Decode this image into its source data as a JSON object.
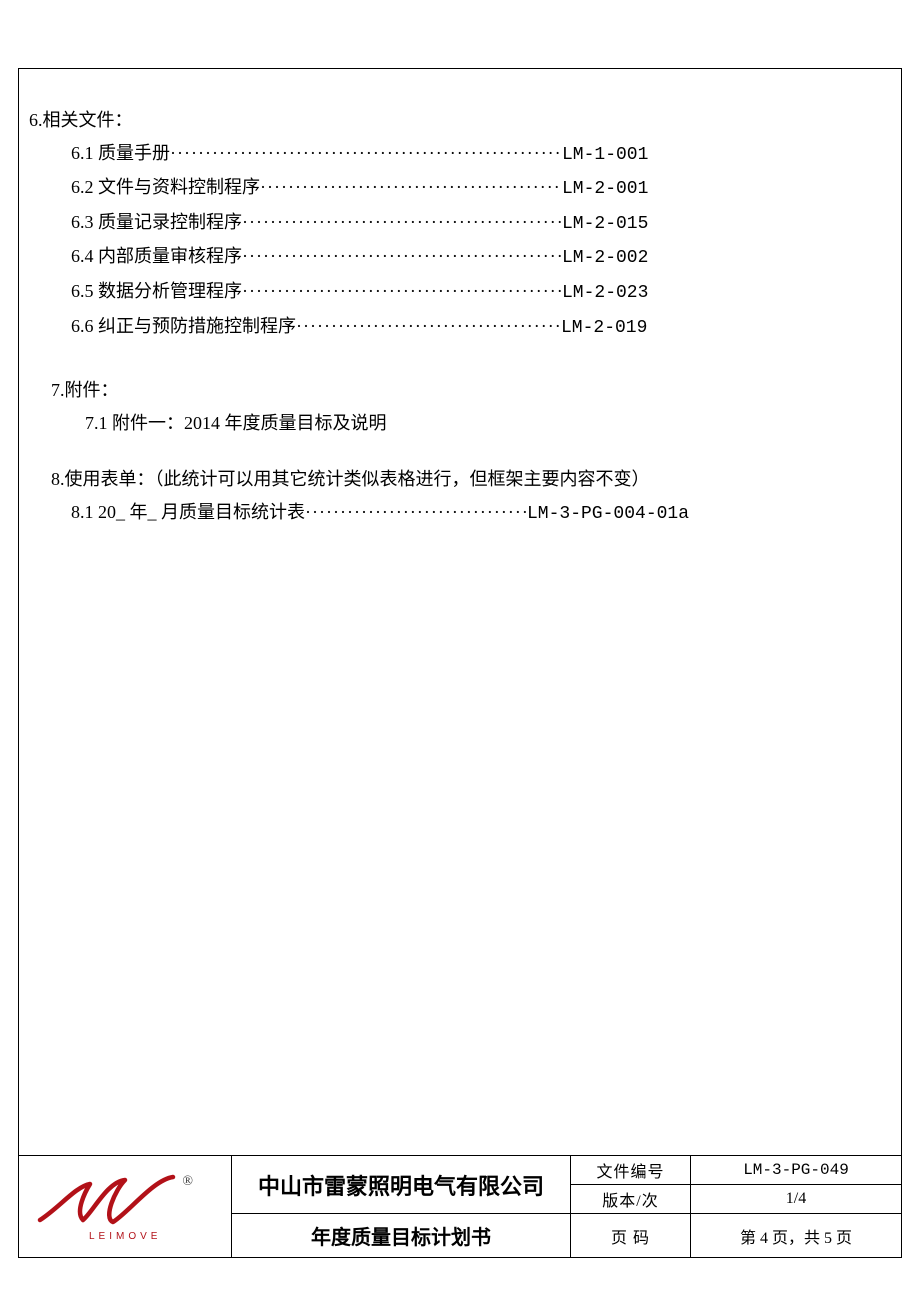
{
  "section6": {
    "title": "6.相关文件：",
    "items": [
      {
        "label": "6.1 质量手册",
        "code": "LM-1-001"
      },
      {
        "label": "6.2 文件与资料控制程序",
        "code": "LM-2-001"
      },
      {
        "label": "6.3 质量记录控制程序",
        "code": "LM-2-015"
      },
      {
        "label": "6.4 内部质量审核程序",
        "code": "LM-2-002"
      },
      {
        "label": "6.5 数据分析管理程序",
        "code": "LM-2-023"
      },
      {
        "label": "6.6 纠正与预防措施控制程序",
        "code": "LM-2-019"
      }
    ]
  },
  "section7": {
    "title": "7.附件：",
    "item": "7.1 附件一：2014 年度质量目标及说明"
  },
  "section8": {
    "title": "8.使用表单：（此统计可以用其它统计类似表格进行，但框架主要内容不变）",
    "item_label": "8.1 20_ 年_ 月质量目标统计表",
    "item_code": "LM-3-PG-004-01a"
  },
  "footer": {
    "logo_text": "LEIMOVE",
    "registered": "®",
    "company": "中山市雷蒙照明电气有限公司",
    "doc_title": "年度质量目标计划书",
    "labels": {
      "doc_no": "文件编号",
      "version": "版本/次",
      "page": "页    码"
    },
    "values": {
      "doc_no": "LM-3-PG-049",
      "version": "1/4",
      "page": "第 4 页，共 5 页"
    }
  }
}
